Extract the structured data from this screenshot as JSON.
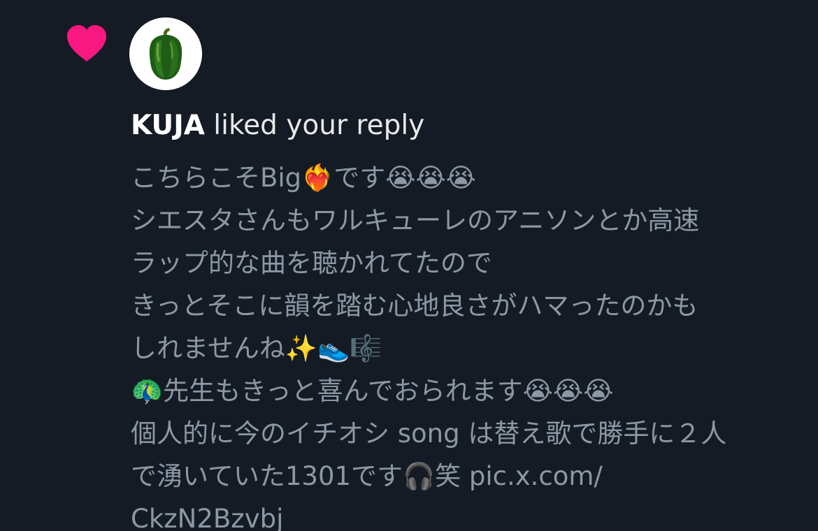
{
  "notification": {
    "user_name": "KUJA",
    "action_text": " liked your reply",
    "avatar_icon": "green-bell-pepper",
    "type_icon": "heart-icon",
    "heart_color": "#f91880"
  },
  "reply": {
    "lines": [
      "こちらこそBig❤️‍🔥です😭😭😭",
      "シエスタさんもワルキューレのアニソンとか高速",
      "ラップ的な曲を聴かれてたので",
      "きっとそこに韻を踏む心地良さがハマったのかも",
      "しれませんね✨👟🎼",
      "🦚先生もきっと喜んでおられます😭😭😭",
      "個人的に今のイチオシ song は替え歌で勝手に２人",
      "で湧いていた1301です🎧笑 pic.x.com/",
      "CkzN2Bzvbj"
    ]
  }
}
